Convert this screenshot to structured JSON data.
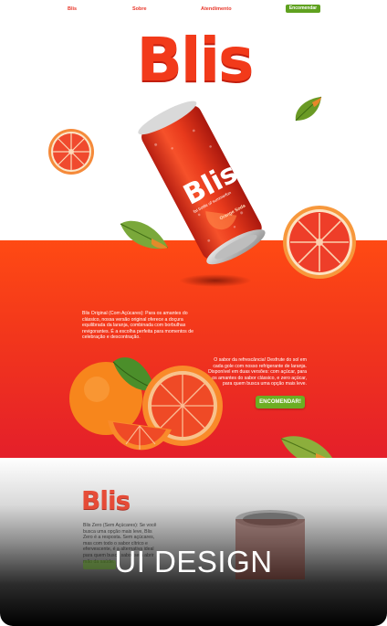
{
  "nav": {
    "links": [
      "Blis",
      "Sobre",
      "Atendimento"
    ],
    "cta_label": "Encomendar"
  },
  "hero": {
    "brand_title": "Blis",
    "can_brand": "Blis",
    "can_tagline": "fat bottle of summerfun",
    "can_flavor": "Orange Soda"
  },
  "section_red": {
    "description_left": "Blis Original (Com Açúcares): Para os amantes do clássico, nossa versão original oferece a doçura equilibrada da laranja, combinada com borbulhas revigorantes. É a escolha perfeita para momentos de celebração e descontração.",
    "description_right": "O sabor da refrescância! Desfrute do sol em cada gole com nosso refrigerante de laranja. Disponível em duas versões: com açúcar, para os amantes do sabor clássico, e zero açúcar, para quem busca uma opção mais leve.",
    "cta_label": "ENCOMENDAR!"
  },
  "section_lower": {
    "brand_title": "Blis",
    "description": "Blis Zero (Sem Açúcares): Se você busca uma opção mais leve, Blis Zero é a resposta. Sem açúcares, mas com todo o sabor cítrico e efervescente, é a alternativa ideal para quem busca sabor sem abrir mão da saúde."
  },
  "overlay_caption": "UI DESIGN",
  "colors": {
    "brand_red": "#f23a1a",
    "band_orange": "#ff4a13",
    "cta_green": "#6cae23"
  }
}
